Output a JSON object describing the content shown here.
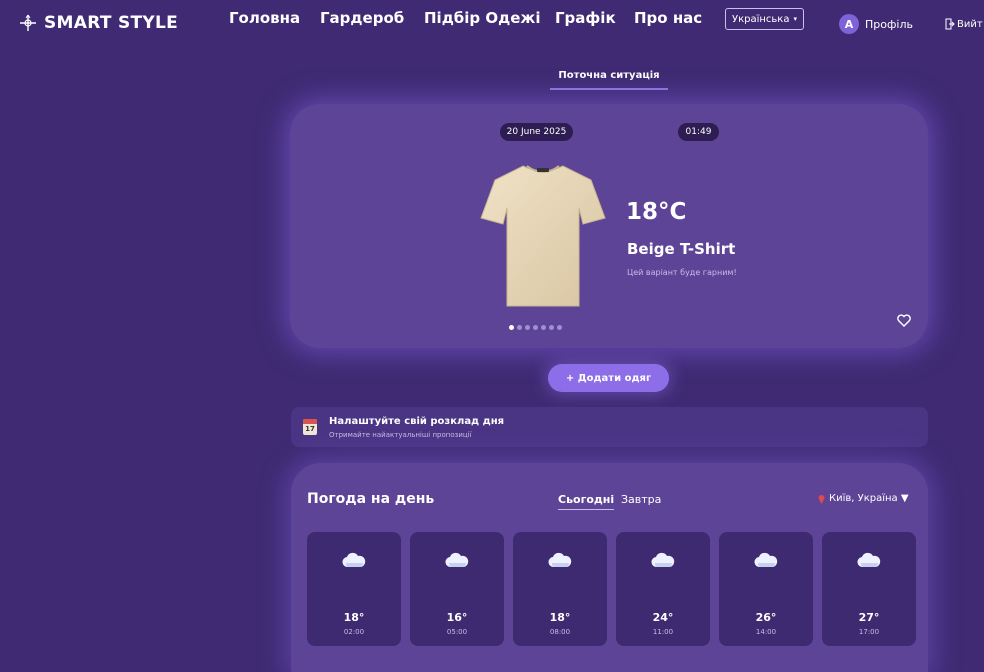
{
  "nav": {
    "logo": "SMART STYLE",
    "menu": [
      "Головна",
      "Гардероб",
      "Підбір Одежі",
      "Графік",
      "Про нас"
    ],
    "language": "Українська",
    "avatar_letter": "A",
    "profile": "Профіль",
    "logout": "Вийт"
  },
  "main": {
    "tab": "Поточна ситуація",
    "date": "20 June 2025",
    "time": "01:49",
    "temperature": "18°C",
    "item_name": "Beige T-Shirt",
    "item_subtitle": "Цей варіант буде гарним!",
    "add_button": "+ Додати одяг",
    "carousel": {
      "count": 7,
      "active": 0
    }
  },
  "schedule": {
    "icon_day": "17",
    "title": "Налаштуйте свій розклад дня",
    "subtitle": "Отримайте найактуальніші пропозиції"
  },
  "weather": {
    "title": "Погода на день",
    "tab_today": "Сьогодні",
    "tab_tomorrow": "Завтра",
    "location": "Київ, Україна ▼",
    "forecast": [
      {
        "temp": "18°",
        "time": "02:00",
        "icon": "cloud-icon"
      },
      {
        "temp": "16°",
        "time": "05:00",
        "icon": "cloud-icon"
      },
      {
        "temp": "18°",
        "time": "08:00",
        "icon": "cloud-icon"
      },
      {
        "temp": "24°",
        "time": "11:00",
        "icon": "cloud-icon"
      },
      {
        "temp": "26°",
        "time": "14:00",
        "icon": "cloud-icon"
      },
      {
        "temp": "27°",
        "time": "17:00",
        "icon": "cloud-icon"
      }
    ]
  },
  "colors": {
    "background": "#3f2a73",
    "card": "#5e4497",
    "accent": "#8d6ee8"
  }
}
